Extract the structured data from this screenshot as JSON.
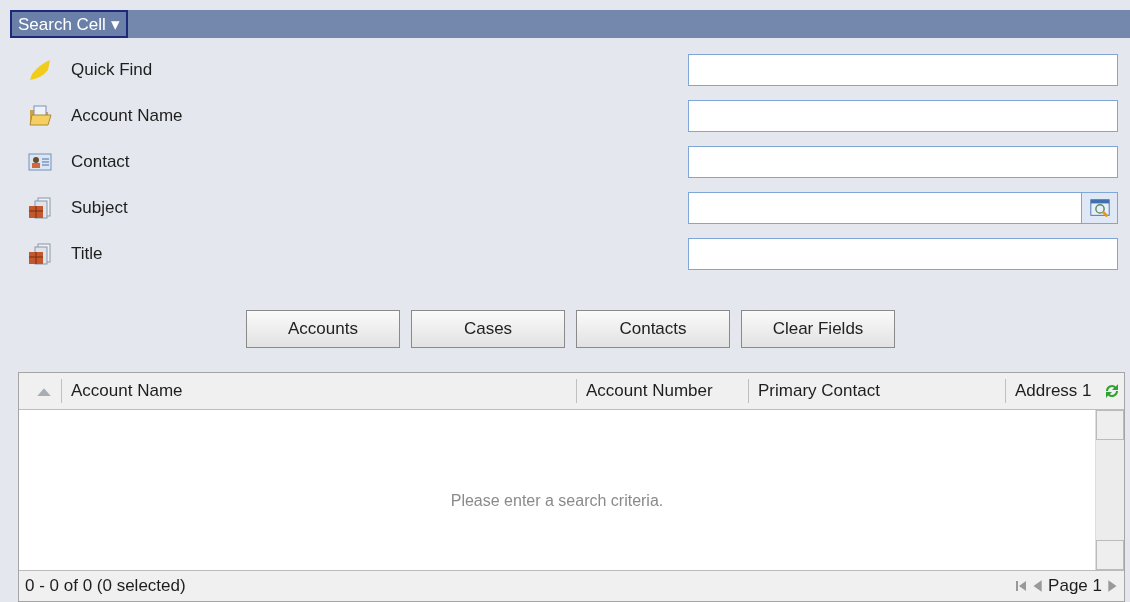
{
  "header": {
    "title": "Search Cell",
    "dropdown_caret": "▾"
  },
  "fields": [
    {
      "label": "Quick Find",
      "kind": "text"
    },
    {
      "label": "Account Name",
      "kind": "text"
    },
    {
      "label": "Contact",
      "kind": "text"
    },
    {
      "label": "Subject",
      "kind": "lookup"
    },
    {
      "label": "Title",
      "kind": "text"
    }
  ],
  "buttons": [
    "Accounts",
    "Cases",
    "Contacts",
    "Clear Fields"
  ],
  "grid": {
    "columns": [
      "Account Name",
      "Account Number",
      "Primary Contact",
      "Address 1"
    ],
    "empty_message": "Please enter a search criteria.",
    "status": "0 - 0 of 0 (0 selected)",
    "page": "Page 1"
  }
}
